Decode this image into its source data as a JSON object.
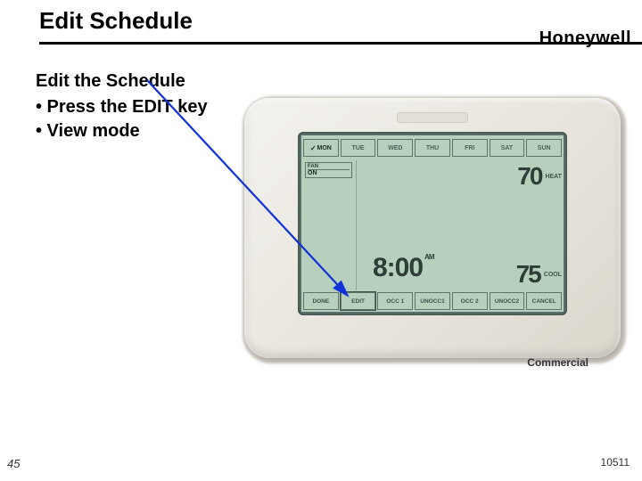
{
  "title": "Edit Schedule",
  "brand": "Honeywell",
  "content": {
    "subhead": "Edit the Schedule",
    "bullets": [
      "• Press the EDIT key",
      "• View mode"
    ]
  },
  "thermostat": {
    "days": [
      "MON",
      "TUE",
      "WED",
      "THU",
      "FRI",
      "SAT",
      "SUN"
    ],
    "active_day_index": 0,
    "fan": {
      "label": "FAN",
      "value": "ON"
    },
    "time": {
      "value": "8:00",
      "ampm": "AM"
    },
    "heat": {
      "value": "70",
      "label": "HEAT"
    },
    "cool": {
      "value": "75",
      "label": "COOL"
    },
    "buttons": [
      "DONE",
      "EDIT",
      "OCC 1",
      "UNOCC1",
      "OCC 2",
      "UNOCC2",
      "CANCEL"
    ]
  },
  "caption": "Commercial",
  "page_number": "45",
  "doc_id": "10511"
}
